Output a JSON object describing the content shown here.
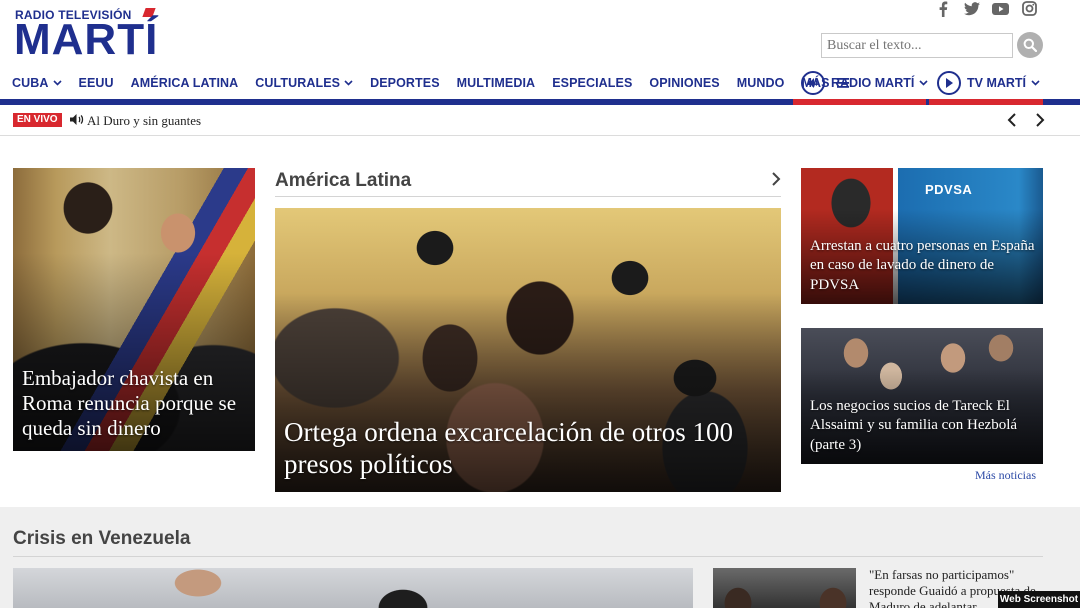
{
  "brand": {
    "top_line": "RADIO TELEVISIÓN",
    "name": "MARTÍ",
    "blue": "#1f2f8e",
    "red": "#d8282f"
  },
  "social": [
    "facebook-icon",
    "twitter-icon",
    "youtube-icon",
    "instagram-icon"
  ],
  "search": {
    "placeholder": "Buscar el texto..."
  },
  "nav": {
    "items": [
      {
        "label": "CUBA",
        "has_dropdown": true
      },
      {
        "label": "EEUU",
        "has_dropdown": false
      },
      {
        "label": "AMÉRICA LATINA",
        "has_dropdown": false
      },
      {
        "label": "CULTURALES",
        "has_dropdown": true
      },
      {
        "label": "DEPORTES",
        "has_dropdown": false
      },
      {
        "label": "MULTIMEDIA",
        "has_dropdown": false
      },
      {
        "label": "ESPECIALES",
        "has_dropdown": false
      },
      {
        "label": "OPINIONES",
        "has_dropdown": false
      },
      {
        "label": "MUNDO",
        "has_dropdown": false
      },
      {
        "label": "MÁS",
        "has_dropdown": false
      }
    ],
    "radio": "RADIO MARTÍ",
    "tv": "TV MARTÍ"
  },
  "live": {
    "badge": "EN VIVO",
    "program": "Al Duro y sin guantes"
  },
  "top_stories": {
    "left": {
      "headline": "Embajador chavista en Roma renuncia porque se queda sin dinero"
    },
    "section_title": "América Latina",
    "main": {
      "headline": "Ortega ordena excarcelación de otros 100 presos políticos"
    },
    "right1": {
      "headline": "Arrestan a cuatro personas en España en caso de lavado de dinero de PDVSA",
      "image_text": "PDVSA"
    },
    "right2": {
      "headline": "Los negocios sucios de Tareck El Alssaimi y su familia con Hezbolá (parte 3)"
    },
    "more_link": "Más noticias"
  },
  "crisis": {
    "title": "Crisis en Venezuela",
    "side_story": "\"En farsas no participamos\" responde Guaidó a propuesta de Maduro de adelantar"
  },
  "watermark": "Web Screenshot"
}
